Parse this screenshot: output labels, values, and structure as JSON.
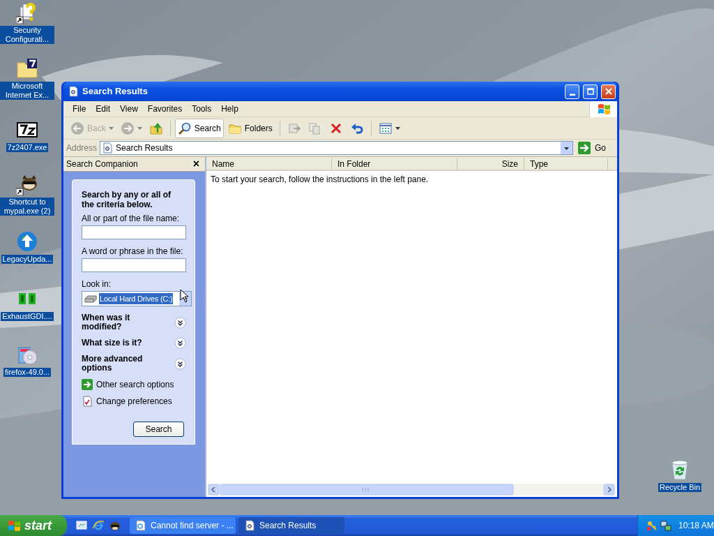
{
  "desktop": {
    "icons": [
      {
        "kind": "help-shortcut",
        "label": "Security Configurati..."
      },
      {
        "kind": "folder-seven",
        "label": "Microsoft Internet Ex..."
      },
      {
        "kind": "sevenzip",
        "label": "7z2407.exe"
      },
      {
        "kind": "raccoon-shortcut",
        "label": "Shortcut to mypal.exe (2)"
      },
      {
        "kind": "globe-arrow",
        "label": "LegacyUpda..."
      },
      {
        "kind": "gdi",
        "label": "ExhaustGDI...."
      },
      {
        "kind": "installer",
        "label": "firefox-49.0..."
      },
      {
        "kind": "recycle",
        "label": "Recycle Bin"
      }
    ]
  },
  "window": {
    "title": "Search Results",
    "menu": [
      "File",
      "Edit",
      "View",
      "Favorites",
      "Tools",
      "Help"
    ],
    "toolbar": [
      {
        "kind": "back",
        "label": "Back",
        "dropdown": true,
        "disabled": true,
        "selected": false
      },
      {
        "kind": "forward",
        "dropdown": true,
        "disabled": true,
        "selected": false
      },
      {
        "kind": "up",
        "disabled": false,
        "selected": false
      },
      {
        "kind": "separator"
      },
      {
        "kind": "search",
        "label": "Search",
        "disabled": false,
        "selected": true
      },
      {
        "kind": "folders",
        "label": "Folders",
        "disabled": false,
        "selected": false
      },
      {
        "kind": "separator"
      },
      {
        "kind": "move",
        "disabled": true,
        "selected": false
      },
      {
        "kind": "copy",
        "disabled": true,
        "selected": false
      },
      {
        "kind": "delete",
        "disabled": false,
        "selected": false
      },
      {
        "kind": "undo",
        "disabled": false,
        "selected": false
      },
      {
        "kind": "separator"
      },
      {
        "kind": "views",
        "dropdown": true,
        "disabled": false,
        "selected": false
      }
    ],
    "address": {
      "label": "Address",
      "value": "Search Results",
      "go": "Go"
    },
    "companion": {
      "title": "Search Companion",
      "close": "×",
      "items": [
        {
          "kind": "heading",
          "text": "Search by any or all of the criteria below."
        },
        {
          "kind": "field",
          "label": "All or part of the file name:"
        },
        {
          "kind": "field",
          "label": "A word or phrase in the file:"
        },
        {
          "kind": "select",
          "label": "Look in:",
          "value": "Local Hard Drives (C:)",
          "highlighted": true
        },
        {
          "kind": "expander",
          "text": "When was it modified?",
          "expanded": false
        },
        {
          "kind": "expander",
          "text": "What size is it?",
          "expanded": false
        },
        {
          "kind": "expander",
          "text": "More advanced options",
          "expanded": false
        },
        {
          "kind": "option-link",
          "text": "Other search options"
        },
        {
          "kind": "preference-link",
          "text": "Change preferences"
        },
        {
          "kind": "button",
          "text": "Search"
        }
      ]
    },
    "results": {
      "columns": [
        {
          "label": "Name",
          "kind": "text"
        },
        {
          "label": "In Folder",
          "kind": "text"
        },
        {
          "label": "Size",
          "kind": "number"
        },
        {
          "label": "Type",
          "kind": "text"
        }
      ],
      "message": "To start your search, follow the instructions in the left pane."
    }
  },
  "taskbar": {
    "start": "start",
    "quick_launch": [
      {
        "kind": "show-desktop"
      },
      {
        "kind": "browser"
      },
      {
        "kind": "raccoon"
      }
    ],
    "tasks": [
      {
        "kind": "browser-page",
        "label": "Cannot find server - ...",
        "selected": false
      },
      {
        "kind": "search-doc",
        "label": "Search Results",
        "selected": true
      }
    ],
    "tray": [
      {
        "kind": "keys"
      },
      {
        "kind": "network"
      }
    ],
    "clock": "10:18 AM"
  }
}
